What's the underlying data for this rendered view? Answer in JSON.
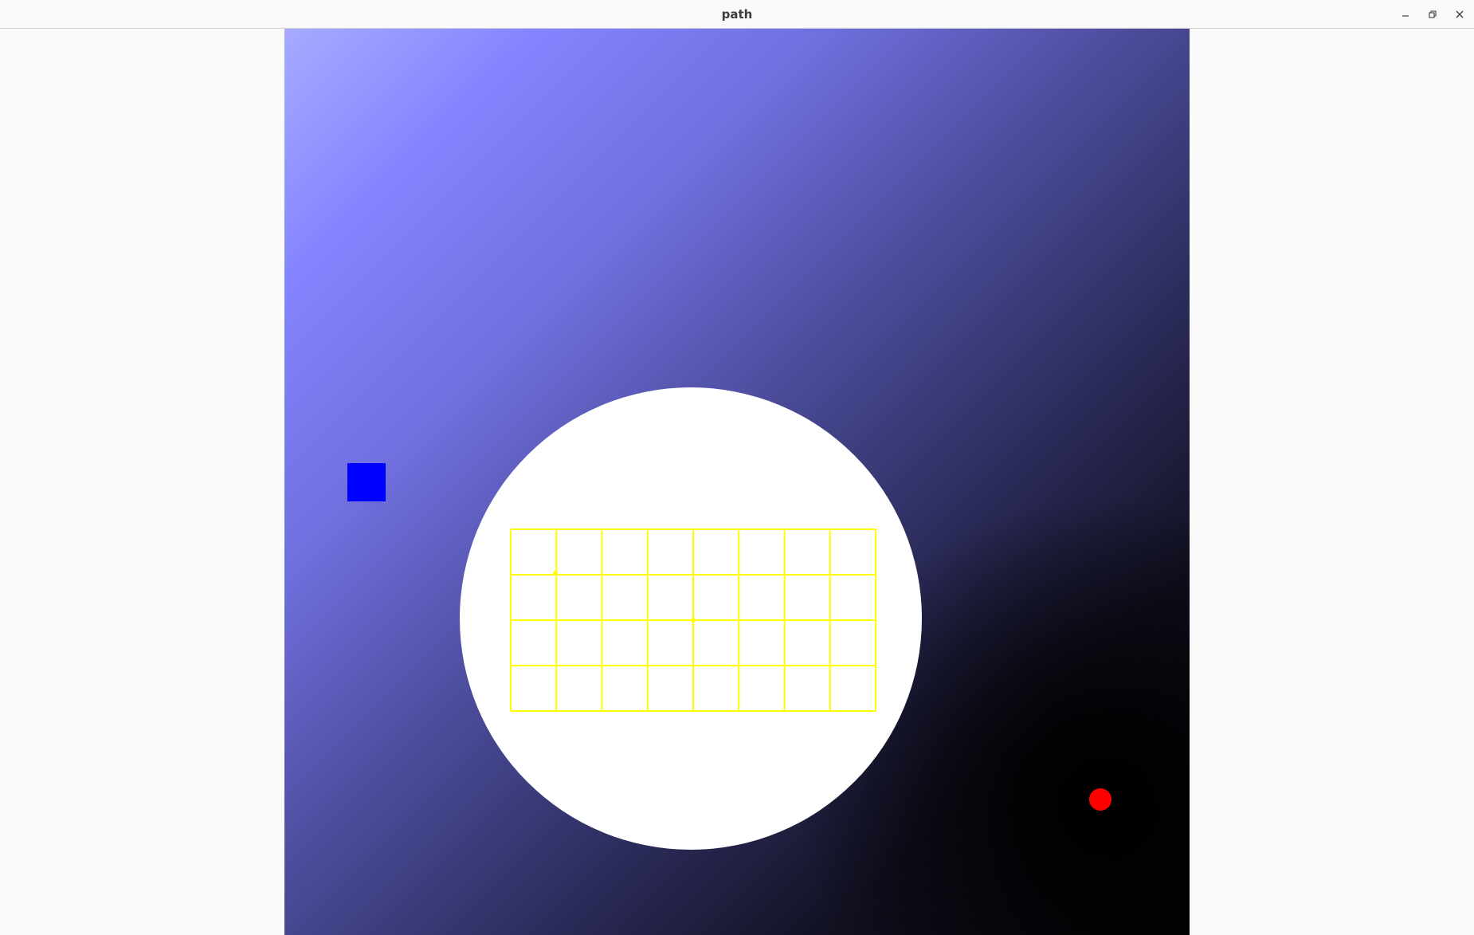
{
  "window": {
    "title": "path",
    "controls": {
      "minimize_icon": "minimize-icon",
      "maximize_icon": "maximize-icon",
      "close_icon": "close-icon"
    }
  },
  "scene": {
    "colors": {
      "background_light": "#a7aaff",
      "background_mid": "#4a4a98",
      "background_dark": "#050509",
      "light_disk": "#ffffff",
      "disk_halo": "#8082ff",
      "square": "#0000ff",
      "grid": "#ffff00",
      "dot": "#ff0000"
    },
    "grid": {
      "columns": 8,
      "rows": 4
    }
  }
}
